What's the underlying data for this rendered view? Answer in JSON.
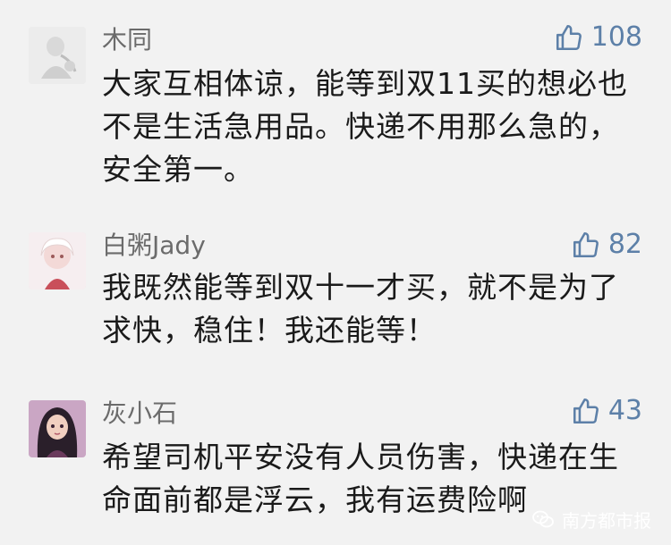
{
  "comments": [
    {
      "username": "木同",
      "likes": "108",
      "text": "大家互相体谅，能等到双11买的想必也不是生活急用品。快递不用那么急的，安全第一。"
    },
    {
      "username": "白粥Jady",
      "likes": "82",
      "text": "我既然能等到双十一才买，就不是为了求快，稳住！我还能等！"
    },
    {
      "username": "灰小石",
      "likes": "43",
      "text": "希望司机平安没有人员伤害，快递在生命面前都是浮云，我有运费险啊"
    }
  ],
  "watermark": {
    "text": "南方都市报",
    "icon": "wechat-icon"
  },
  "colors": {
    "background": "#f2f2f2",
    "username": "#6b6b6b",
    "like": "#5d80a8",
    "text": "#1a1a1a"
  }
}
